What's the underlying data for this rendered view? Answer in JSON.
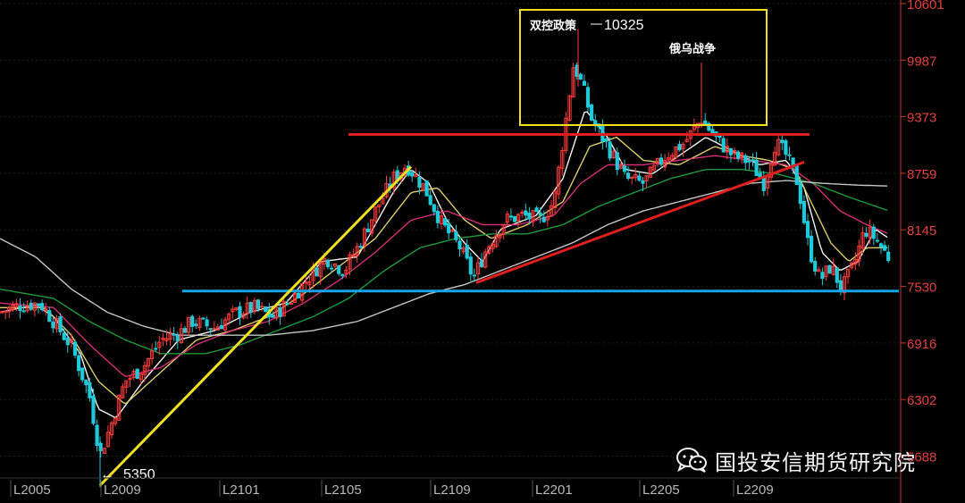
{
  "chart_data": {
    "type": "candlestick",
    "y_axis": {
      "ticks": [
        "10601",
        "9987",
        "9373",
        "8759",
        "8145",
        "7530",
        "6916",
        "6302",
        "5688"
      ],
      "range": [
        5450,
        10640
      ],
      "side": "right"
    },
    "x_axis": {
      "labels": [
        "L2005",
        "L2009",
        "L2101",
        "L2105",
        "L2109",
        "L2201",
        "L2205",
        "L2209"
      ]
    },
    "annotations": {
      "box_title": "双控政策",
      "high_label": "10325",
      "war_label": "俄乌战争",
      "low_label": "5350"
    },
    "levels": {
      "support": 7480,
      "resistance": 9180
    },
    "trendlines": [
      {
        "name": "",
        "color": "#f0e020",
        "from": {
          "bar": 112,
          "price": 5370
        },
        "to": {
          "bar": 460,
          "price": 8830
        }
      },
      {
        "name": "",
        "color": "#e01e1e",
        "from": {
          "bar": 533,
          "price": 7570
        },
        "to": {
          "bar": 900,
          "price": 8880
        }
      }
    ],
    "price_path": [
      [
        0,
        7250
      ],
      [
        20,
        7320
      ],
      [
        45,
        7350
      ],
      [
        60,
        7150
      ],
      [
        80,
        6880
      ],
      [
        100,
        6350
      ],
      [
        112,
        5700
      ],
      [
        125,
        6050
      ],
      [
        140,
        6500
      ],
      [
        160,
        6650
      ],
      [
        180,
        6950
      ],
      [
        200,
        7020
      ],
      [
        215,
        7150
      ],
      [
        240,
        7080
      ],
      [
        265,
        7250
      ],
      [
        285,
        7300
      ],
      [
        305,
        7200
      ],
      [
        325,
        7380
      ],
      [
        345,
        7620
      ],
      [
        365,
        7840
      ],
      [
        385,
        7700
      ],
      [
        400,
        7950
      ],
      [
        420,
        8350
      ],
      [
        440,
        8700
      ],
      [
        455,
        8850
      ],
      [
        475,
        8600
      ],
      [
        495,
        8200
      ],
      [
        515,
        7950
      ],
      [
        530,
        7620
      ],
      [
        545,
        7950
      ],
      [
        565,
        8250
      ],
      [
        585,
        8300
      ],
      [
        605,
        8250
      ],
      [
        620,
        8450
      ],
      [
        632,
        9250
      ],
      [
        642,
        9950
      ],
      [
        652,
        9700
      ],
      [
        662,
        9350
      ],
      [
        680,
        9050
      ],
      [
        700,
        8700
      ],
      [
        720,
        8650
      ],
      [
        745,
        8950
      ],
      [
        765,
        9080
      ],
      [
        785,
        9350
      ],
      [
        800,
        9150
      ],
      [
        820,
        8950
      ],
      [
        840,
        8880
      ],
      [
        855,
        8650
      ],
      [
        868,
        9100
      ],
      [
        880,
        8950
      ],
      [
        893,
        8650
      ],
      [
        905,
        7950
      ],
      [
        918,
        7600
      ],
      [
        930,
        7750
      ],
      [
        942,
        7500
      ],
      [
        955,
        7750
      ],
      [
        968,
        8150
      ],
      [
        980,
        8050
      ],
      [
        994,
        7850
      ]
    ],
    "moving_averages": [
      {
        "color": "#ffffff",
        "path": [
          [
            0,
            7250
          ],
          [
            40,
            7330
          ],
          [
            60,
            7200
          ],
          [
            90,
            6800
          ],
          [
            110,
            6200
          ],
          [
            130,
            6100
          ],
          [
            160,
            6500
          ],
          [
            200,
            6950
          ],
          [
            240,
            7050
          ],
          [
            280,
            7250
          ],
          [
            320,
            7350
          ],
          [
            360,
            7800
          ],
          [
            400,
            7850
          ],
          [
            440,
            8550
          ],
          [
            460,
            8800
          ],
          [
            480,
            8650
          ],
          [
            500,
            8250
          ],
          [
            520,
            8000
          ],
          [
            540,
            7800
          ],
          [
            560,
            8150
          ],
          [
            600,
            8300
          ],
          [
            630,
            8700
          ],
          [
            655,
            9450
          ],
          [
            680,
            9150
          ],
          [
            700,
            8800
          ],
          [
            730,
            8750
          ],
          [
            760,
            8950
          ],
          [
            790,
            9150
          ],
          [
            820,
            9000
          ],
          [
            850,
            8850
          ],
          [
            880,
            8900
          ],
          [
            900,
            8600
          ],
          [
            920,
            7900
          ],
          [
            940,
            7700
          ],
          [
            960,
            7800
          ],
          [
            980,
            8150
          ],
          [
            995,
            8050
          ]
        ]
      },
      {
        "color": "#e8d870",
        "path": [
          [
            0,
            7300
          ],
          [
            50,
            7300
          ],
          [
            80,
            7000
          ],
          [
            110,
            6500
          ],
          [
            140,
            6250
          ],
          [
            180,
            6600
          ],
          [
            220,
            6950
          ],
          [
            260,
            7050
          ],
          [
            300,
            7200
          ],
          [
            340,
            7450
          ],
          [
            380,
            7750
          ],
          [
            420,
            8050
          ],
          [
            460,
            8550
          ],
          [
            490,
            8600
          ],
          [
            520,
            8250
          ],
          [
            550,
            8050
          ],
          [
            590,
            8200
          ],
          [
            630,
            8450
          ],
          [
            660,
            9050
          ],
          [
            690,
            9150
          ],
          [
            720,
            8900
          ],
          [
            760,
            8850
          ],
          [
            800,
            9050
          ],
          [
            830,
            8950
          ],
          [
            860,
            8900
          ],
          [
            890,
            8800
          ],
          [
            910,
            8400
          ],
          [
            930,
            8000
          ],
          [
            950,
            7800
          ],
          [
            970,
            7950
          ],
          [
            995,
            7950
          ]
        ]
      },
      {
        "color": "#e0307a",
        "path": [
          [
            0,
            7350
          ],
          [
            60,
            7300
          ],
          [
            100,
            6900
          ],
          [
            140,
            6550
          ],
          [
            180,
            6650
          ],
          [
            220,
            6900
          ],
          [
            260,
            7050
          ],
          [
            300,
            7150
          ],
          [
            340,
            7350
          ],
          [
            380,
            7600
          ],
          [
            420,
            7900
          ],
          [
            460,
            8250
          ],
          [
            500,
            8350
          ],
          [
            540,
            8200
          ],
          [
            580,
            8200
          ],
          [
            620,
            8300
          ],
          [
            650,
            8650
          ],
          [
            680,
            8850
          ],
          [
            720,
            8850
          ],
          [
            760,
            8900
          ],
          [
            800,
            8950
          ],
          [
            840,
            8900
          ],
          [
            880,
            8850
          ],
          [
            910,
            8650
          ],
          [
            940,
            8350
          ],
          [
            970,
            8200
          ],
          [
            995,
            8100
          ]
        ]
      },
      {
        "color": "#20a040",
        "path": [
          [
            0,
            7500
          ],
          [
            60,
            7400
          ],
          [
            100,
            7150
          ],
          [
            140,
            6950
          ],
          [
            180,
            6800
          ],
          [
            230,
            6800
          ],
          [
            270,
            6900
          ],
          [
            310,
            7050
          ],
          [
            350,
            7200
          ],
          [
            390,
            7400
          ],
          [
            430,
            7700
          ],
          [
            470,
            7950
          ],
          [
            510,
            8050
          ],
          [
            550,
            8100
          ],
          [
            590,
            8100
          ],
          [
            630,
            8200
          ],
          [
            670,
            8400
          ],
          [
            710,
            8550
          ],
          [
            750,
            8700
          ],
          [
            790,
            8800
          ],
          [
            830,
            8800
          ],
          [
            870,
            8750
          ],
          [
            910,
            8650
          ],
          [
            950,
            8500
          ],
          [
            995,
            8350
          ]
        ]
      },
      {
        "color": "#d0d0d0",
        "path": [
          [
            0,
            8050
          ],
          [
            40,
            7850
          ],
          [
            80,
            7500
          ],
          [
            120,
            7250
          ],
          [
            160,
            7100
          ],
          [
            200,
            7000
          ],
          [
            250,
            7000
          ],
          [
            300,
            7000
          ],
          [
            350,
            7050
          ],
          [
            400,
            7150
          ],
          [
            440,
            7300
          ],
          [
            480,
            7450
          ],
          [
            520,
            7550
          ],
          [
            560,
            7700
          ],
          [
            600,
            7850
          ],
          [
            640,
            8000
          ],
          [
            680,
            8200
          ],
          [
            720,
            8350
          ],
          [
            760,
            8450
          ],
          [
            800,
            8550
          ],
          [
            840,
            8650
          ],
          [
            880,
            8680
          ],
          [
            920,
            8650
          ],
          [
            960,
            8630
          ],
          [
            995,
            8620
          ]
        ]
      }
    ],
    "colors": {
      "up": "#ff3b3b",
      "down": "#21c8d8",
      "support": "#18a4e8",
      "resistance": "#e01e1e",
      "box": "#f0e020",
      "axis": "#c8382e"
    }
  },
  "watermark": {
    "icon": "wechat-icon",
    "text": "国投安信期货研究院"
  }
}
